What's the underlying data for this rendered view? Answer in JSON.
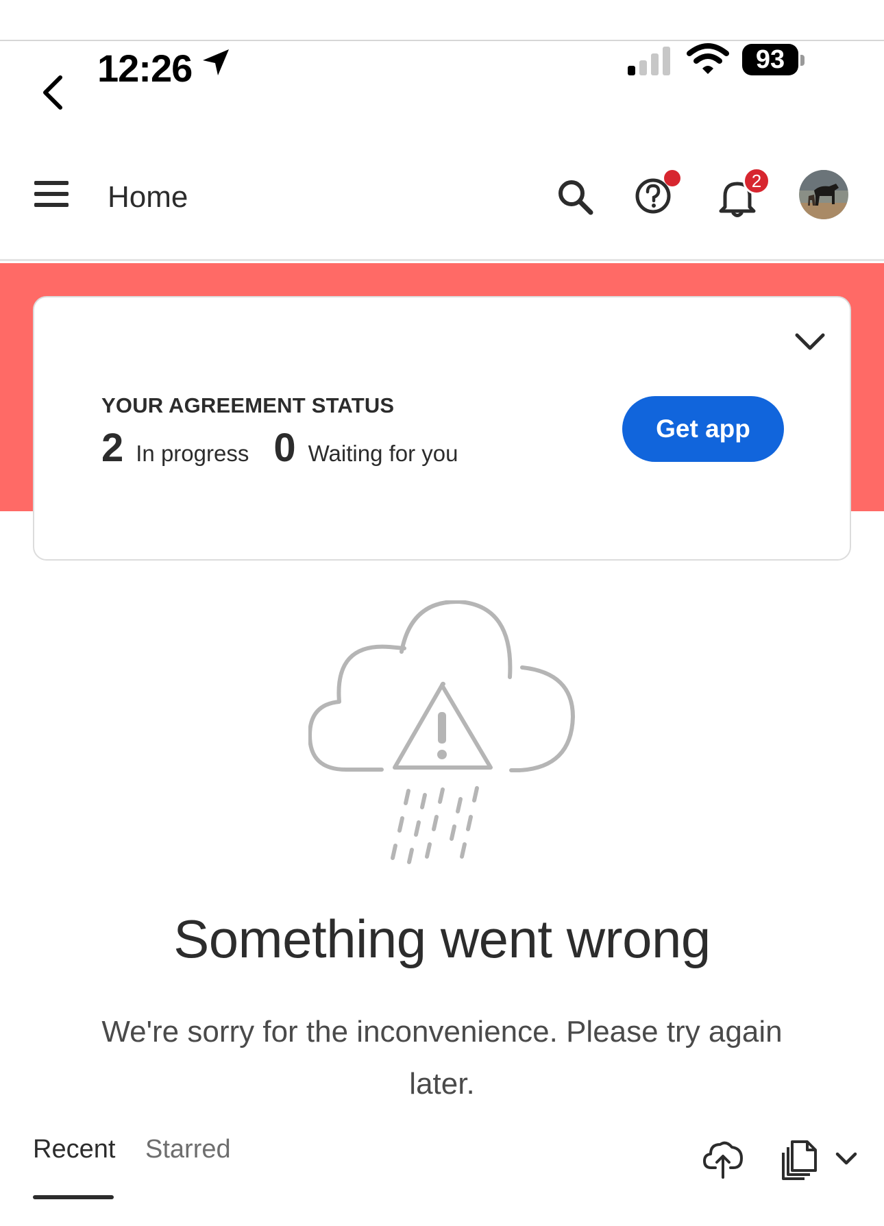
{
  "status_bar": {
    "time": "12:26",
    "battery": "93",
    "icons": [
      "location-arrow-icon",
      "cellular-signal-icon",
      "wifi-icon",
      "battery-icon"
    ]
  },
  "header": {
    "title": "Home",
    "notification_count": "2",
    "icons": [
      "hamburger-menu-icon",
      "search-icon",
      "help-icon",
      "bell-icon"
    ]
  },
  "agreement_status": {
    "heading": "YOUR AGREEMENT STATUS",
    "in_progress_count": "2",
    "in_progress_label": "In progress",
    "waiting_count": "0",
    "waiting_label": "Waiting for you",
    "get_app_label": "Get app"
  },
  "error": {
    "title": "Something went wrong",
    "message": "We're sorry for the inconvenience. Please try again later.",
    "illustration": "cloud-warning-rain-icon"
  },
  "tabs": {
    "items": [
      "Recent",
      "Starred"
    ],
    "selected": "Recent"
  },
  "colors": {
    "banner": "#ff6a66",
    "primary_button": "#1165dc",
    "badge": "#d7262f",
    "illustration_stroke": "#b5b5b5"
  }
}
